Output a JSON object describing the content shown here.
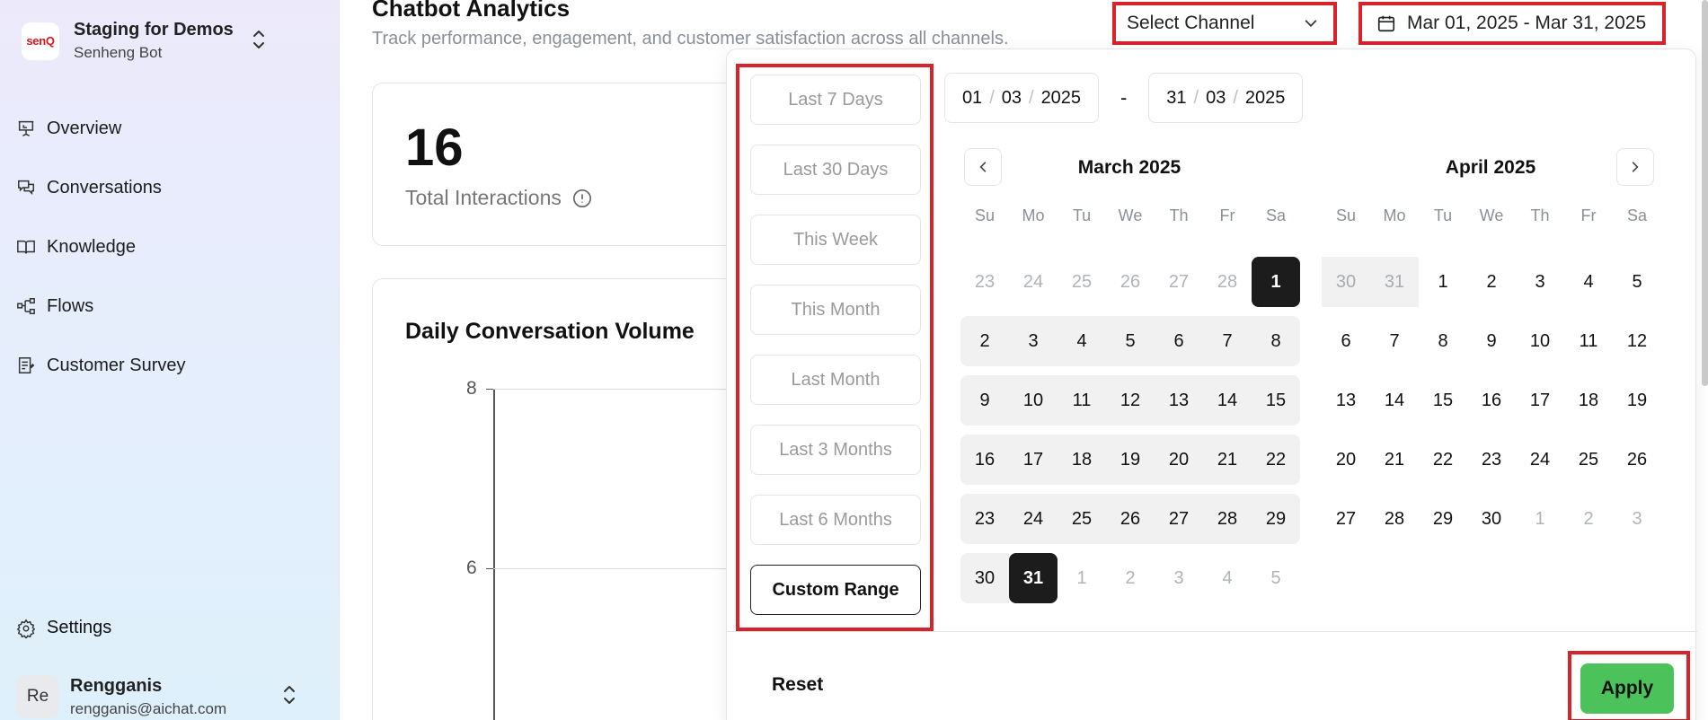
{
  "sidebar": {
    "workspace": {
      "logo_text": "senQ",
      "name": "Staging for Demos",
      "subtitle": "Senheng Bot"
    },
    "items": [
      {
        "label": "Overview",
        "icon": "presentation-icon"
      },
      {
        "label": "Conversations",
        "icon": "chat-icon"
      },
      {
        "label": "Knowledge",
        "icon": "book-icon"
      },
      {
        "label": "Flows",
        "icon": "flow-icon"
      },
      {
        "label": "Customer Survey",
        "icon": "survey-icon"
      }
    ],
    "settings_label": "Settings",
    "user": {
      "initials": "Re",
      "name": "Rengganis",
      "email": "rengganis@aichat.com"
    }
  },
  "header": {
    "title": "Chatbot Analytics",
    "subtitle": "Track performance, engagement, and customer satisfaction across all channels.",
    "channel_label": "Select Channel",
    "date_range": "Mar 01, 2025 - Mar 31, 2025"
  },
  "metric": {
    "value": "16",
    "label": "Total Interactions"
  },
  "chart_card": {
    "title": "Daily Conversation Volume",
    "y_ticks": [
      "8",
      "6"
    ]
  },
  "chart_data": {
    "type": "line",
    "title": "Daily Conversation Volume",
    "xlabel": "",
    "ylabel": "",
    "y_ticks": [
      8,
      6
    ],
    "series": []
  },
  "picker": {
    "presets": [
      "Last 7 Days",
      "Last 30 Days",
      "This Week",
      "This Month",
      "Last Month",
      "Last 3 Months",
      "Last 6 Months",
      "Custom Range"
    ],
    "start": {
      "d": "01",
      "m": "03",
      "y": "2025"
    },
    "end": {
      "d": "31",
      "m": "03",
      "y": "2025"
    },
    "dash": "-",
    "weekdays": [
      "Su",
      "Mo",
      "Tu",
      "We",
      "Th",
      "Fr",
      "Sa"
    ],
    "left_month": {
      "title": "March 2025",
      "days": [
        "23",
        "24",
        "25",
        "26",
        "27",
        "28",
        "1",
        "2",
        "3",
        "4",
        "5",
        "6",
        "7",
        "8",
        "9",
        "10",
        "11",
        "12",
        "13",
        "14",
        "15",
        "16",
        "17",
        "18",
        "19",
        "20",
        "21",
        "22",
        "23",
        "24",
        "25",
        "26",
        "27",
        "28",
        "29",
        "30",
        "31",
        "1",
        "2",
        "3",
        "4",
        "5"
      ]
    },
    "right_month": {
      "title": "April 2025",
      "days": [
        "30",
        "31",
        "1",
        "2",
        "3",
        "4",
        "5",
        "6",
        "7",
        "8",
        "9",
        "10",
        "11",
        "12",
        "13",
        "14",
        "15",
        "16",
        "17",
        "18",
        "19",
        "20",
        "21",
        "22",
        "23",
        "24",
        "25",
        "26",
        "27",
        "28",
        "29",
        "30",
        "1",
        "2",
        "3"
      ]
    },
    "reset_label": "Reset",
    "apply_label": "Apply"
  },
  "colors": {
    "highlight": "#d8232a",
    "apply": "#4cc35a",
    "selected": "#1c1c1c",
    "range": "#f1f1f1"
  }
}
